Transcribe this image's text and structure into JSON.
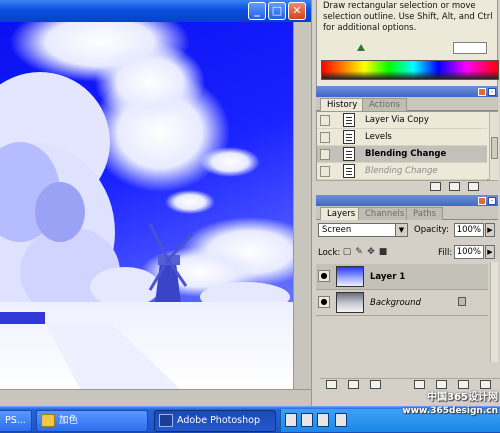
{
  "document_window": {
    "minimize_glyph": "_",
    "maximize_glyph": "□",
    "close_glyph": "✕"
  },
  "info_palette": {
    "hint_text": "Draw rectangular selection or move selection outline.  Use Shift, Alt, and Ctrl for additional options."
  },
  "history_palette": {
    "tabs": [
      "History",
      "Actions"
    ],
    "items": [
      {
        "label": "Layer Via Copy",
        "state": "normal"
      },
      {
        "label": "Levels",
        "state": "normal"
      },
      {
        "label": "Blending Change",
        "state": "selected"
      },
      {
        "label": "Blending Change",
        "state": "undone"
      }
    ]
  },
  "layers_palette": {
    "tabs": [
      "Layers",
      "Channels",
      "Paths"
    ],
    "blend_mode": "Screen",
    "opacity_label": "Opacity:",
    "opacity_value": "100%",
    "lock_label": "Lock:",
    "fill_label": "Fill:",
    "fill_value": "100%",
    "layers": [
      {
        "name": "Layer 1",
        "selected": true,
        "visible": true
      },
      {
        "name": "Background",
        "selected": false,
        "visible": true,
        "locked": true
      }
    ]
  },
  "taskbar": {
    "items": [
      {
        "label": "PS...",
        "icon": "photoshop-icon"
      },
      {
        "label": "加色",
        "icon": "folder-icon"
      },
      {
        "label": "Adobe Photoshop",
        "icon": "photoshop-icon",
        "active": true
      }
    ]
  },
  "watermark": {
    "line1": "中国365设计网",
    "line2": "www.365design.cn"
  },
  "colors": {
    "titlebar": "#0a4fe0",
    "taskbar": "#2463d6",
    "palette_bg": "#d4d0c8",
    "selected_row": "#c2c0b8"
  }
}
